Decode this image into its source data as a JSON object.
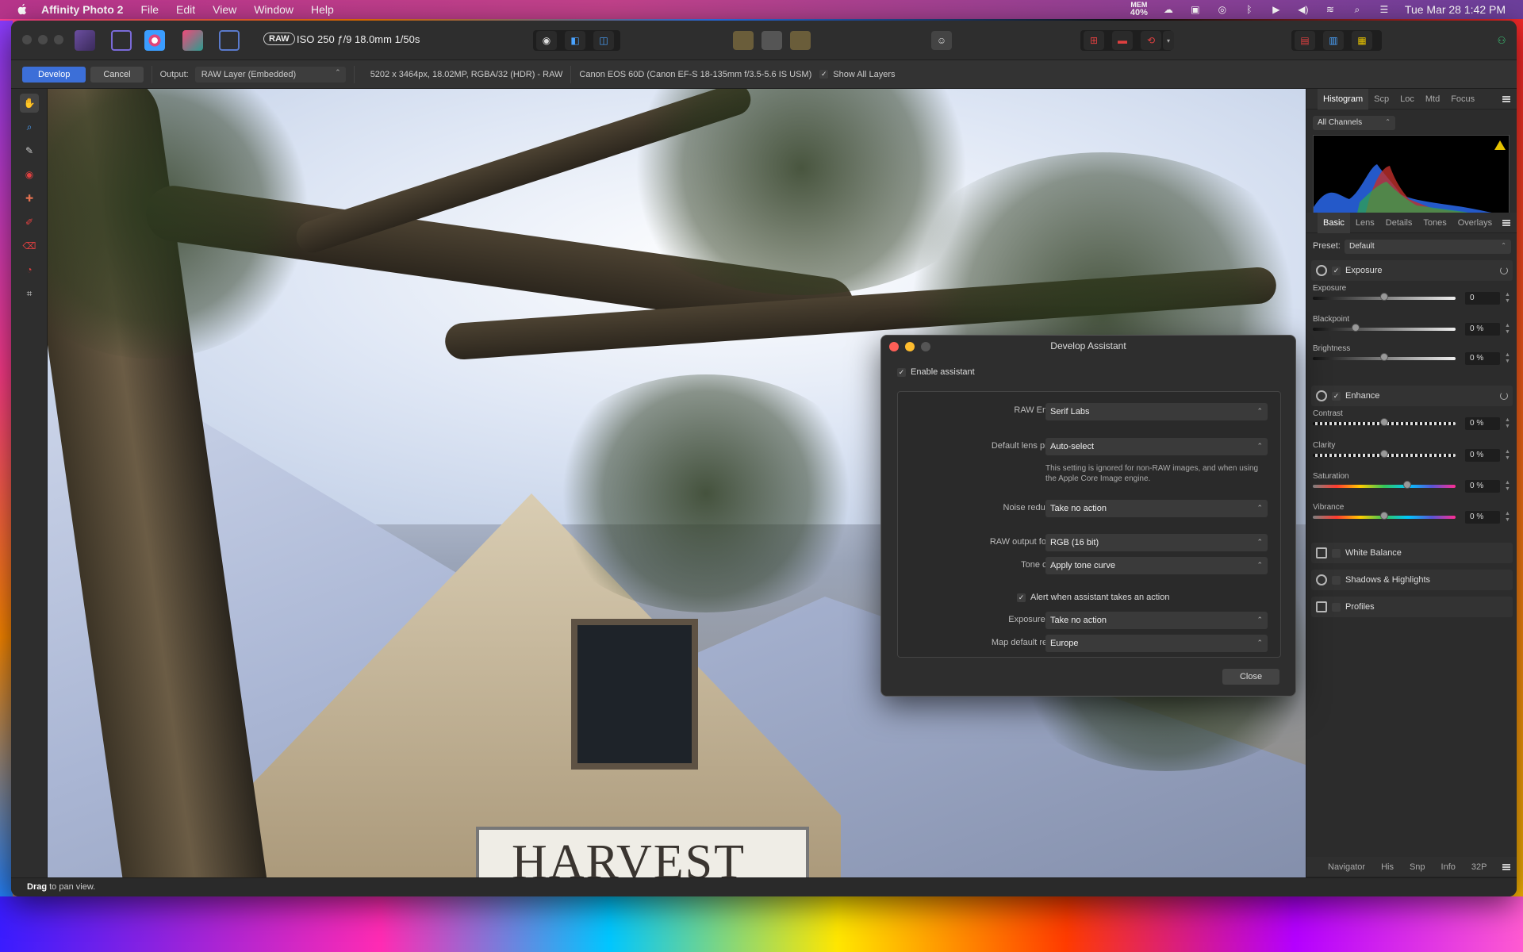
{
  "menubar": {
    "app_name": "Affinity Photo 2",
    "items": [
      "File",
      "Edit",
      "View",
      "Window",
      "Help"
    ],
    "mem_label": "MEM",
    "mem_value": "40%",
    "clock": "Tue Mar 28  1:42 PM"
  },
  "toolbar": {
    "raw_badge": "RAW",
    "exif": "ISO 250 ƒ/9 18.0mm 1/50s"
  },
  "context": {
    "develop_label": "Develop",
    "cancel_label": "Cancel",
    "output_label": "Output:",
    "output_value": "RAW Layer (Embedded)",
    "image_info": "5202 x 3464px, 18.02MP, RGBA/32 (HDR) - RAW",
    "camera_info": "Canon EOS 60D (Canon EF-S 18-135mm f/3.5-5.6 IS USM)",
    "show_layers_label": "Show All Layers"
  },
  "canvas": {
    "sign_text": "HARVEST"
  },
  "panel_top": {
    "tabs": [
      "Histogram",
      "Scp",
      "Loc",
      "Mtd",
      "Focus"
    ],
    "channels": "All Channels"
  },
  "panel_mid": {
    "tabs": [
      "Basic",
      "Lens",
      "Details",
      "Tones",
      "Overlays"
    ],
    "preset_label": "Preset:",
    "preset_value": "Default",
    "exposure_section": "Exposure",
    "enhance_section": "Enhance",
    "sliders": [
      {
        "label": "Exposure",
        "value": "0",
        "pos": 0.5
      },
      {
        "label": "Blackpoint",
        "value": "0 %",
        "pos": 0.3
      },
      {
        "label": "Brightness",
        "value": "0 %",
        "pos": 0.5
      },
      {
        "label": "Contrast",
        "value": "0 %",
        "pos": 0.5
      },
      {
        "label": "Clarity",
        "value": "0 %",
        "pos": 0.5
      },
      {
        "label": "Saturation",
        "value": "0 %",
        "pos": 0.66
      },
      {
        "label": "Vibrance",
        "value": "0 %",
        "pos": 0.5
      }
    ],
    "collapsed_sections": [
      "White Balance",
      "Shadows & Highlights",
      "Profiles"
    ]
  },
  "panel_bottom": {
    "tabs": [
      "Navigator",
      "His",
      "Snp",
      "Info",
      "32P"
    ]
  },
  "statusbar": {
    "bold": "Drag",
    "text": " to pan view."
  },
  "dialog": {
    "title": "Develop Assistant",
    "enable_label": "Enable assistant",
    "rows": [
      {
        "label": "RAW Engine:",
        "value": "Serif Labs"
      },
      {
        "label": "Default lens profile:",
        "value": "Auto-select"
      },
      {
        "label": "Noise reduction:",
        "value": "Take no action"
      },
      {
        "label": "RAW output format:",
        "value": "RGB (16 bit)"
      },
      {
        "label": "Tone curve:",
        "value": "Apply tone curve"
      },
      {
        "label": "Exposure bias:",
        "value": "Take no action"
      },
      {
        "label": "Map default region:",
        "value": "Europe"
      }
    ],
    "note": "This setting is ignored for non-RAW images, and when using the Apple Core Image engine.",
    "alert_label": "Alert when assistant takes an action",
    "close_label": "Close"
  },
  "colors": {
    "accent": "#3c6fd8",
    "close_red": "#ff5f57",
    "minimize_yellow": "#febc2e",
    "warning": "#e6c200"
  }
}
